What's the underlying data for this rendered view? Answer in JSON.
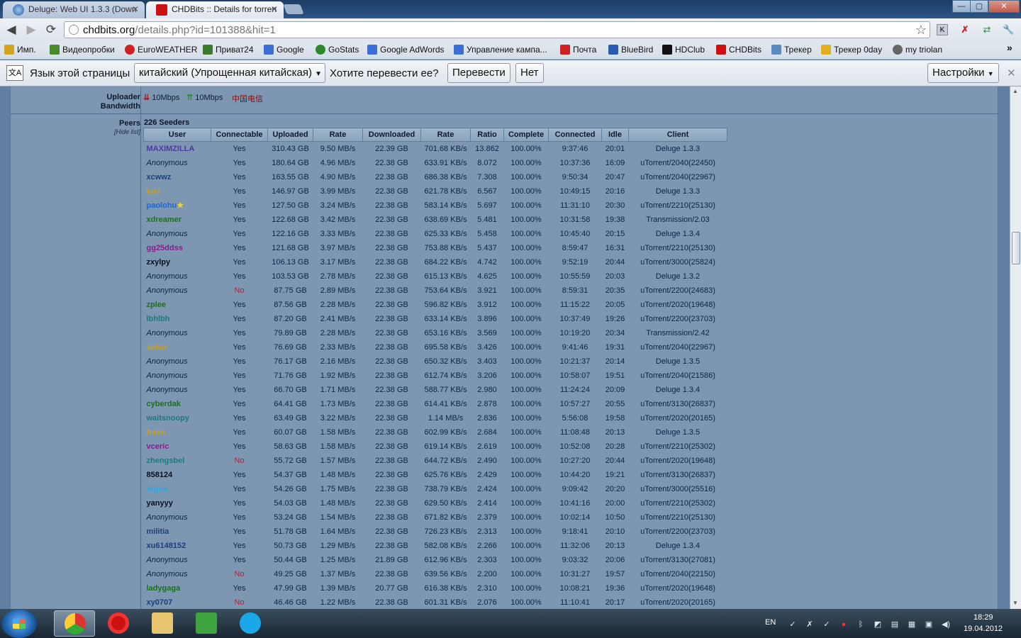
{
  "browser": {
    "tabs": [
      {
        "title": "Deluge: Web UI 1.3.3 (Down",
        "active": false
      },
      {
        "title": "CHDBits :: Details for torren",
        "active": true
      }
    ],
    "window_controls": {
      "minimize": "—",
      "maximize": "▢",
      "close": "✕"
    },
    "address": {
      "domain": "chdbits.org",
      "path": "/details.php?id=101388&hit=1"
    }
  },
  "bookmarks": [
    {
      "label": "Имп.",
      "color": "#d4a420"
    },
    {
      "label": "Видеопробки",
      "color": "#4a8a2a"
    },
    {
      "label": "EuroWEATHER",
      "color": "#c22"
    },
    {
      "label": "Приват24",
      "color": "#3a7a2a"
    },
    {
      "label": "Google",
      "color": "#3b6fd6"
    },
    {
      "label": "GoStats",
      "color": "#2a8a2a"
    },
    {
      "label": "Google AdWords",
      "color": "#3b6fd6"
    },
    {
      "label": "Управление кампа...",
      "color": "#3b6fd6"
    },
    {
      "label": "Почта",
      "color": "#c22"
    },
    {
      "label": "BlueBird",
      "color": "#2a5ab0"
    },
    {
      "label": "HDClub",
      "color": "#111"
    },
    {
      "label": "CHDBits",
      "color": "#c11"
    },
    {
      "label": "Трекер",
      "color": "#5a8ac0"
    },
    {
      "label": "Трекер 0day",
      "color": "#e0b020"
    },
    {
      "label": "my triolan",
      "color": "#666"
    }
  ],
  "bookmarks_more": "»",
  "translate_bar": {
    "prompt": "Язык этой страницы",
    "language": "китайский (Упрощенная китайская)",
    "question": "Хотите перевести ее?",
    "translate_btn": "Перевести",
    "no_btn": "Нет",
    "settings_btn": "Настройки",
    "close": "✕"
  },
  "uploader_bandwidth": {
    "label_line1": "Uploader",
    "label_line2": "Bandwidth",
    "download": "10Mbps",
    "upload": "10Mbps",
    "isp": "中国电信"
  },
  "peers": {
    "label": "Peers",
    "hide_list": "[Hide list]",
    "seeders_count": "226 Seeders",
    "columns": [
      "User",
      "Connectable",
      "Uploaded",
      "Rate",
      "Downloaded",
      "Rate",
      "Ratio",
      "Complete",
      "Connected",
      "Idle",
      "Client"
    ],
    "rows": [
      {
        "user": "MAXIMZILLA",
        "color": "#4b3aa0",
        "conn": "Yes",
        "up": "310.43 GB",
        "up_rate": "9.50 MB/s",
        "down": "22.39 GB",
        "down_rate": "701.68 KB/s",
        "ratio": "13.862",
        "complete": "100.00%",
        "connected": "9:37:46",
        "idle": "20:01",
        "client": "Deluge 1.3.3"
      },
      {
        "user": "Anonymous",
        "color": "",
        "conn": "Yes",
        "up": "180.64 GB",
        "up_rate": "4.96 MB/s",
        "down": "22.38 GB",
        "down_rate": "633.91 KB/s",
        "ratio": "8.072",
        "complete": "100.00%",
        "connected": "10:37:36",
        "idle": "16:09",
        "client": "uTorrent/2040(22450)"
      },
      {
        "user": "xcwwz",
        "color": "#1e3e7a",
        "conn": "Yes",
        "up": "163.55 GB",
        "up_rate": "4.90 MB/s",
        "down": "22.38 GB",
        "down_rate": "686.38 KB/s",
        "ratio": "7.308",
        "complete": "100.00%",
        "connected": "9:50:34",
        "idle": "20:47",
        "client": "uTorrent/2040(22967)"
      },
      {
        "user": "luxi",
        "color": "#c9a020",
        "conn": "Yes",
        "up": "146.97 GB",
        "up_rate": "3.99 MB/s",
        "down": "22.38 GB",
        "down_rate": "621.78 KB/s",
        "ratio": "6.567",
        "complete": "100.00%",
        "connected": "10:49:15",
        "idle": "20:16",
        "client": "Deluge 1.3.3"
      },
      {
        "user": "paolohu",
        "color": "#1c66d8",
        "star": true,
        "conn": "Yes",
        "up": "127.50 GB",
        "up_rate": "3.24 MB/s",
        "down": "22.38 GB",
        "down_rate": "583.14 KB/s",
        "ratio": "5.697",
        "complete": "100.00%",
        "connected": "11:31:10",
        "idle": "20:30",
        "client": "uTorrent/2210(25130)"
      },
      {
        "user": "xdreamer",
        "color": "#1f6e1f",
        "conn": "Yes",
        "up": "122.68 GB",
        "up_rate": "3.42 MB/s",
        "down": "22.38 GB",
        "down_rate": "638.69 KB/s",
        "ratio": "5.481",
        "complete": "100.00%",
        "connected": "10:31:58",
        "idle": "19:38",
        "client": "Transmission/2.03"
      },
      {
        "user": "Anonymous",
        "color": "",
        "conn": "Yes",
        "up": "122.16 GB",
        "up_rate": "3.33 MB/s",
        "down": "22.38 GB",
        "down_rate": "625.33 KB/s",
        "ratio": "5.458",
        "complete": "100.00%",
        "connected": "10:45:40",
        "idle": "20:15",
        "client": "Deluge 1.3.4"
      },
      {
        "user": "gg25ddss",
        "color": "#8a1c8a",
        "conn": "Yes",
        "up": "121.68 GB",
        "up_rate": "3.97 MB/s",
        "down": "22.38 GB",
        "down_rate": "753.88 KB/s",
        "ratio": "5.437",
        "complete": "100.00%",
        "connected": "8:59:47",
        "idle": "16:31",
        "client": "uTorrent/2210(25130)"
      },
      {
        "user": "zxylpy",
        "color": "#0a1020",
        "conn": "Yes",
        "up": "106.13 GB",
        "up_rate": "3.17 MB/s",
        "down": "22.38 GB",
        "down_rate": "684.22 KB/s",
        "ratio": "4.742",
        "complete": "100.00%",
        "connected": "9:52:19",
        "idle": "20:44",
        "client": "uTorrent/3000(25824)"
      },
      {
        "user": "Anonymous",
        "color": "",
        "conn": "Yes",
        "up": "103.53 GB",
        "up_rate": "2.78 MB/s",
        "down": "22.38 GB",
        "down_rate": "615.13 KB/s",
        "ratio": "4.625",
        "complete": "100.00%",
        "connected": "10:55:59",
        "idle": "20:03",
        "client": "Deluge 1.3.2"
      },
      {
        "user": "Anonymous",
        "color": "",
        "conn": "No",
        "up": "87.75 GB",
        "up_rate": "2.89 MB/s",
        "down": "22.38 GB",
        "down_rate": "753.64 KB/s",
        "ratio": "3.921",
        "complete": "100.00%",
        "connected": "8:59:31",
        "idle": "20:35",
        "client": "uTorrent/2200(24683)"
      },
      {
        "user": "zplee",
        "color": "#1f6e1f",
        "conn": "Yes",
        "up": "87.56 GB",
        "up_rate": "2.28 MB/s",
        "down": "22.38 GB",
        "down_rate": "596.82 KB/s",
        "ratio": "3.912",
        "complete": "100.00%",
        "connected": "11:15:22",
        "idle": "20:05",
        "client": "uTorrent/2020(19648)"
      },
      {
        "user": "lbhlbh",
        "color": "#1a7a7a",
        "conn": "Yes",
        "up": "87.20 GB",
        "up_rate": "2.41 MB/s",
        "down": "22.38 GB",
        "down_rate": "633.14 KB/s",
        "ratio": "3.896",
        "complete": "100.00%",
        "connected": "10:37:49",
        "idle": "19:26",
        "client": "uTorrent/2200(23703)"
      },
      {
        "user": "Anonymous",
        "color": "",
        "conn": "Yes",
        "up": "79.89 GB",
        "up_rate": "2.28 MB/s",
        "down": "22.38 GB",
        "down_rate": "653.16 KB/s",
        "ratio": "3.569",
        "complete": "100.00%",
        "connected": "10:19:20",
        "idle": "20:34",
        "client": "Transmission/2.42"
      },
      {
        "user": "sokor",
        "color": "#c9a020",
        "conn": "Yes",
        "up": "76.69 GB",
        "up_rate": "2.33 MB/s",
        "down": "22.38 GB",
        "down_rate": "695.58 KB/s",
        "ratio": "3.426",
        "complete": "100.00%",
        "connected": "9:41:46",
        "idle": "19:31",
        "client": "uTorrent/2040(22967)"
      },
      {
        "user": "Anonymous",
        "color": "",
        "conn": "Yes",
        "up": "76.17 GB",
        "up_rate": "2.16 MB/s",
        "down": "22.38 GB",
        "down_rate": "650.32 KB/s",
        "ratio": "3.403",
        "complete": "100.00%",
        "connected": "10:21:37",
        "idle": "20:14",
        "client": "Deluge 1.3.5"
      },
      {
        "user": "Anonymous",
        "color": "",
        "conn": "Yes",
        "up": "71.76 GB",
        "up_rate": "1.92 MB/s",
        "down": "22.38 GB",
        "down_rate": "612.74 KB/s",
        "ratio": "3.206",
        "complete": "100.00%",
        "connected": "10:58:07",
        "idle": "19:51",
        "client": "uTorrent/2040(21586)"
      },
      {
        "user": "Anonymous",
        "color": "",
        "conn": "Yes",
        "up": "66.70 GB",
        "up_rate": "1.71 MB/s",
        "down": "22.38 GB",
        "down_rate": "588.77 KB/s",
        "ratio": "2.980",
        "complete": "100.00%",
        "connected": "11:24:24",
        "idle": "20:09",
        "client": "Deluge 1.3.4"
      },
      {
        "user": "cyberdak",
        "color": "#1f6e1f",
        "conn": "Yes",
        "up": "64.41 GB",
        "up_rate": "1.73 MB/s",
        "down": "22.38 GB",
        "down_rate": "614.41 KB/s",
        "ratio": "2.878",
        "complete": "100.00%",
        "connected": "10:57:27",
        "idle": "20:55",
        "client": "uTorrent/3130(26837)"
      },
      {
        "user": "waitsnoopy",
        "color": "#1a7a7a",
        "conn": "Yes",
        "up": "63.49 GB",
        "up_rate": "3.22 MB/s",
        "down": "22.38 GB",
        "down_rate": "1.14 MB/s",
        "ratio": "2.836",
        "complete": "100.00%",
        "connected": "5:56:08",
        "idle": "19:58",
        "client": "uTorrent/2020(20165)"
      },
      {
        "user": "freen",
        "color": "#c9a020",
        "conn": "Yes",
        "up": "60.07 GB",
        "up_rate": "1.58 MB/s",
        "down": "22.38 GB",
        "down_rate": "602.99 KB/s",
        "ratio": "2.684",
        "complete": "100.00%",
        "connected": "11:08:48",
        "idle": "20:13",
        "client": "Deluge 1.3.5"
      },
      {
        "user": "vceric",
        "color": "#8a1c8a",
        "conn": "Yes",
        "up": "58.63 GB",
        "up_rate": "1.58 MB/s",
        "down": "22.38 GB",
        "down_rate": "619.14 KB/s",
        "ratio": "2.619",
        "complete": "100.00%",
        "connected": "10:52:08",
        "idle": "20:28",
        "client": "uTorrent/2210(25302)"
      },
      {
        "user": "zhengsbel",
        "color": "#1a7a7a",
        "conn": "No",
        "up": "55.72 GB",
        "up_rate": "1.57 MB/s",
        "down": "22.38 GB",
        "down_rate": "644.72 KB/s",
        "ratio": "2.490",
        "complete": "100.00%",
        "connected": "10:27:20",
        "idle": "20:44",
        "client": "uTorrent/2020(19648)"
      },
      {
        "user": "858124",
        "color": "#0a1020",
        "conn": "Yes",
        "up": "54.37 GB",
        "up_rate": "1.48 MB/s",
        "down": "22.38 GB",
        "down_rate": "625.76 KB/s",
        "ratio": "2.429",
        "complete": "100.00%",
        "connected": "10:44:20",
        "idle": "19:21",
        "client": "uTorrent/3130(26837)"
      },
      {
        "user": "argos",
        "color": "#2aa6e0",
        "conn": "Yes",
        "up": "54.26 GB",
        "up_rate": "1.75 MB/s",
        "down": "22.38 GB",
        "down_rate": "738.79 KB/s",
        "ratio": "2.424",
        "complete": "100.00%",
        "connected": "9:09:42",
        "idle": "20:20",
        "client": "uTorrent/3000(25516)"
      },
      {
        "user": "yanyyy",
        "color": "#0a1020",
        "conn": "Yes",
        "up": "54.03 GB",
        "up_rate": "1.48 MB/s",
        "down": "22.38 GB",
        "down_rate": "629.50 KB/s",
        "ratio": "2.414",
        "complete": "100.00%",
        "connected": "10:41:16",
        "idle": "20:00",
        "client": "uTorrent/2210(25302)"
      },
      {
        "user": "Anonymous",
        "color": "",
        "conn": "Yes",
        "up": "53.24 GB",
        "up_rate": "1.54 MB/s",
        "down": "22.38 GB",
        "down_rate": "671.82 KB/s",
        "ratio": "2.379",
        "complete": "100.00%",
        "connected": "10:02:14",
        "idle": "10:50",
        "client": "uTorrent/2210(25130)"
      },
      {
        "user": "militia",
        "color": "#1e3e7a",
        "conn": "Yes",
        "up": "51.78 GB",
        "up_rate": "1.64 MB/s",
        "down": "22.38 GB",
        "down_rate": "726.23 KB/s",
        "ratio": "2.313",
        "complete": "100.00%",
        "connected": "9:18:41",
        "idle": "20:10",
        "client": "uTorrent/2200(23703)"
      },
      {
        "user": "xu6148152",
        "color": "#1e3e7a",
        "conn": "Yes",
        "up": "50.73 GB",
        "up_rate": "1.29 MB/s",
        "down": "22.38 GB",
        "down_rate": "582.08 KB/s",
        "ratio": "2.266",
        "complete": "100.00%",
        "connected": "11:32:06",
        "idle": "20:13",
        "client": "Deluge 1.3.4"
      },
      {
        "user": "Anonymous",
        "color": "",
        "conn": "Yes",
        "up": "50.44 GB",
        "up_rate": "1.25 MB/s",
        "down": "21.89 GB",
        "down_rate": "612.96 KB/s",
        "ratio": "2.303",
        "complete": "100.00%",
        "connected": "9:03:32",
        "idle": "20:06",
        "client": "uTorrent/3130(27081)"
      },
      {
        "user": "Anonymous",
        "color": "",
        "conn": "No",
        "up": "49.25 GB",
        "up_rate": "1.37 MB/s",
        "down": "22.38 GB",
        "down_rate": "639.56 KB/s",
        "ratio": "2.200",
        "complete": "100.00%",
        "connected": "10:31:27",
        "idle": "19:57",
        "client": "uTorrent/2040(22150)"
      },
      {
        "user": "ladygaga",
        "color": "#1f6e1f",
        "conn": "Yes",
        "up": "47.99 GB",
        "up_rate": "1.39 MB/s",
        "down": "20.77 GB",
        "down_rate": "616.38 KB/s",
        "ratio": "2.310",
        "complete": "100.00%",
        "connected": "10:08:21",
        "idle": "19:36",
        "client": "uTorrent/2020(19648)"
      },
      {
        "user": "xy0707",
        "color": "#1e3e7a",
        "conn": "No",
        "up": "46.46 GB",
        "up_rate": "1.22 MB/s",
        "down": "22.38 GB",
        "down_rate": "601.31 KB/s",
        "ratio": "2.076",
        "complete": "100.00%",
        "connected": "11:10:41",
        "idle": "20:17",
        "client": "uTorrent/2020(20165)"
      }
    ]
  },
  "taskbar": {
    "language": "EN",
    "time": "18:29",
    "date": "19.04.2012"
  }
}
